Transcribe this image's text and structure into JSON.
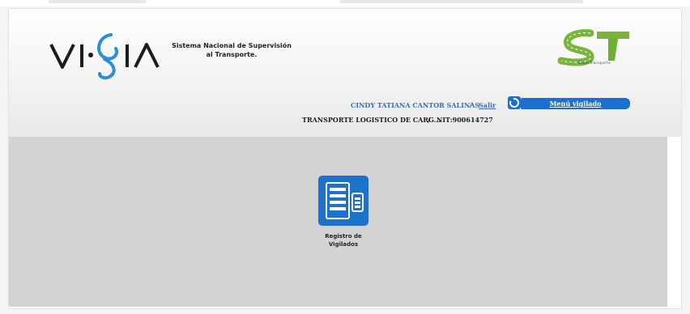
{
  "brand": {
    "logo_text": "VIGIA",
    "tagline_line1": "Sistema Nacional de Supervisión",
    "tagline_line2": "al Transporte.",
    "st_logo_text": "ST",
    "st_logo_caption": "SuperTransporte"
  },
  "user": {
    "name": "CINDY TATIANA  CANTOR SALINAS",
    "separator": "/",
    "logout_label": "Salir",
    "menu_button_label": "Menú vigilado"
  },
  "company": {
    "name": "TRANSPORTE LOGISTICO DE CARG...",
    "separator": "/",
    "nit": "NIT:900614727"
  },
  "tiles": [
    {
      "icon": "document-list-icon",
      "label_line1": "Registro de",
      "label_line2": "Vigilados"
    }
  ],
  "colors": {
    "link_blue": "#3d6fb0",
    "menu_button_bg": "#1c6fd1",
    "content_bg": "#d3d3d3",
    "tile_bg": "#1d72c9"
  }
}
